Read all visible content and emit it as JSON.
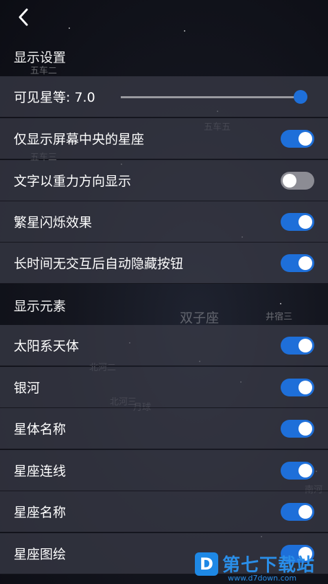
{
  "header": {
    "back_label": "Back"
  },
  "sections": [
    {
      "title": "显示设置"
    },
    {
      "title": "显示元素"
    }
  ],
  "magnitude": {
    "label": "可见星等: 7.0",
    "value": 7.0
  },
  "settings": [
    {
      "label": "仅显示屏幕中央的星座",
      "on": true
    },
    {
      "label": "文字以重力方向显示",
      "on": false
    },
    {
      "label": "繁星闪烁效果",
      "on": true
    },
    {
      "label": "长时间无交互后自动隐藏按钮",
      "on": true
    }
  ],
  "elements": [
    {
      "label": "太阳系天体",
      "on": true
    },
    {
      "label": "银河",
      "on": true
    },
    {
      "label": "星体名称",
      "on": true
    },
    {
      "label": "星座连线",
      "on": true
    },
    {
      "label": "星座名称",
      "on": true
    },
    {
      "label": "星座图绘",
      "on": true
    }
  ],
  "background_labels": [
    "五车二",
    "五车五",
    "五车三",
    "双子座",
    "井宿三",
    "北河二",
    "北河三",
    "月球",
    "南河"
  ],
  "watermark": {
    "brand": "第七下载站",
    "url": "www.d7down.com",
    "logo": "D"
  },
  "colors": {
    "accent": "#1e6fd9",
    "toggle_off": "#8c8c94"
  }
}
